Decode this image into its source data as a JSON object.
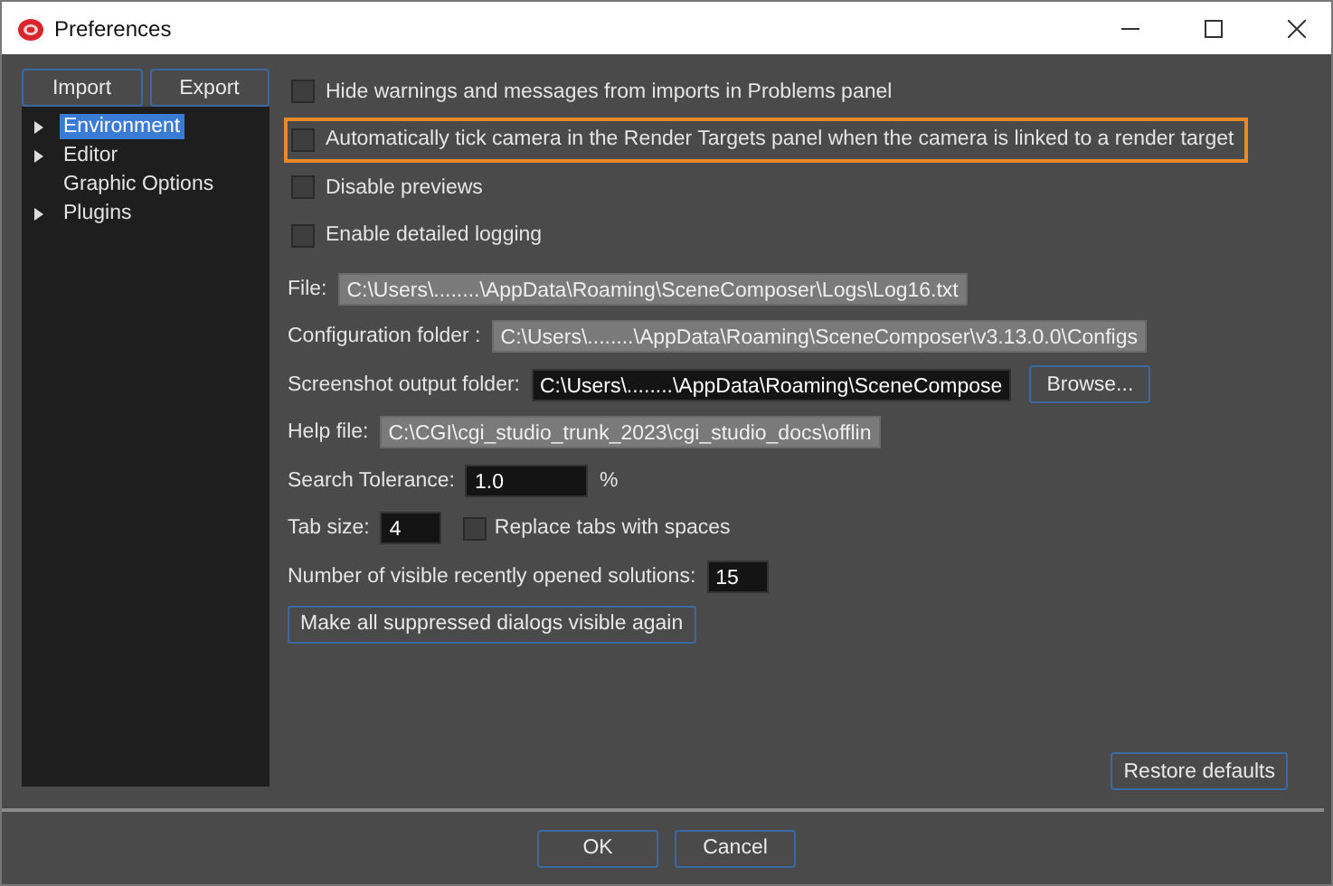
{
  "window": {
    "title": "Preferences"
  },
  "sidebar": {
    "buttons": [
      "Import",
      "Export"
    ],
    "items": [
      {
        "label": "Environment",
        "selected": true,
        "expandable": true
      },
      {
        "label": "Editor",
        "selected": false,
        "expandable": true
      },
      {
        "label": "Graphic Options",
        "selected": false,
        "expandable": false
      },
      {
        "label": "Plugins",
        "selected": false,
        "expandable": true
      }
    ]
  },
  "checkboxes": [
    {
      "label": "Hide warnings and messages from imports in Problems panel",
      "checked": false,
      "focused": false
    },
    {
      "label": "Automatically tick camera in the Render Targets panel when the camera is linked to a render target",
      "checked": false,
      "focused": true
    },
    {
      "label": "Disable previews",
      "checked": false,
      "focused": false
    },
    {
      "label": "Enable detailed logging",
      "checked": false,
      "focused": false
    }
  ],
  "paths": [
    {
      "label": "File:",
      "value": "C:\\Users\\........\\AppData\\Roaming\\SceneComposer\\Logs\\Log16.txt",
      "disabled": true
    },
    {
      "label": "Configuration folder :",
      "value": "C:\\Users\\........\\AppData\\Roaming\\SceneComposer\\v3.13.0.0\\Configs",
      "disabled": true
    },
    {
      "label": "Screenshot output folder:",
      "value": "C:\\Users\\........\\AppData\\Roaming\\SceneCompose",
      "disabled": false,
      "button": "Browse..."
    },
    {
      "label": "Help file:",
      "value": "C:\\CGI\\cgi_studio_trunk_2023\\cgi_studio_docs\\offlin",
      "disabled": true
    }
  ],
  "search_tolerance": {
    "label": "Search Tolerance:",
    "value": "1.0",
    "unit": "%"
  },
  "tab_size": {
    "label": "Tab size:",
    "value": "4",
    "replace_label": "Replace tabs with spaces",
    "replace_checked": false
  },
  "recent_solutions": {
    "label": "Number of visible recently opened solutions:",
    "value": "15"
  },
  "reset_dialogs_button": "Make all suppressed dialogs visible again",
  "restore_button": "Restore defaults",
  "footer_buttons": [
    "OK",
    "Cancel"
  ]
}
